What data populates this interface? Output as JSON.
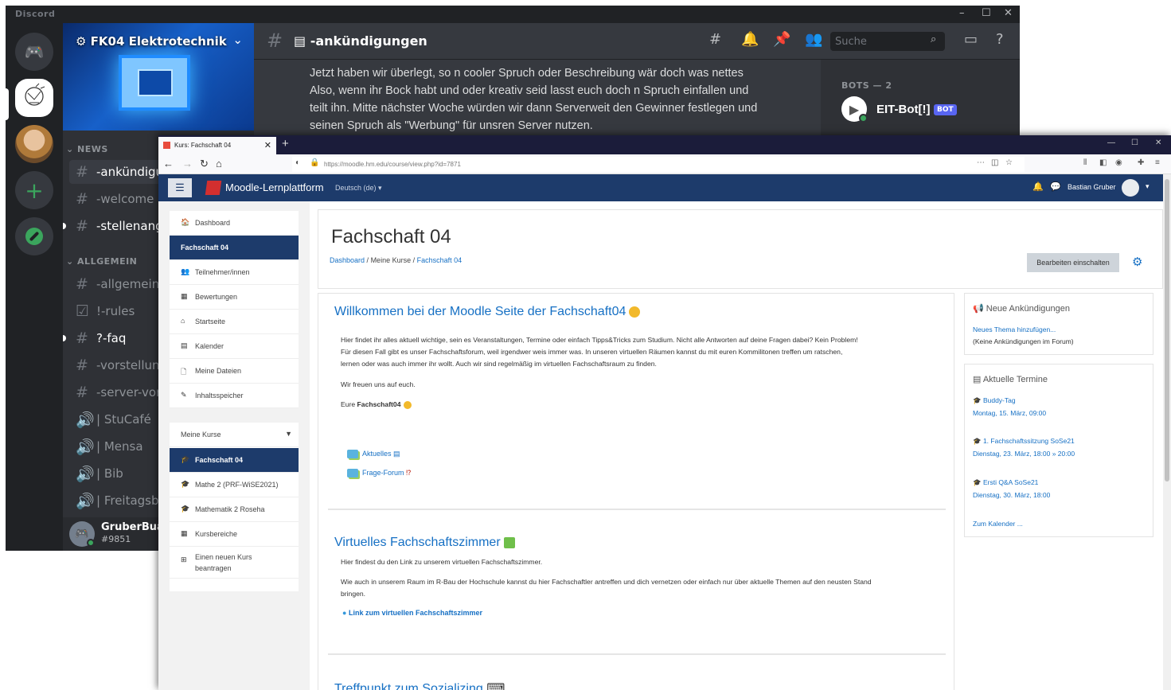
{
  "discord": {
    "app_title": "Discord",
    "window_controls": [
      "–",
      "☐",
      "✕"
    ],
    "server_name": "FK04 Elektrotechnik",
    "categories": [
      "NEWS",
      "ALLGEMEIN"
    ],
    "channels_news": [
      {
        "prefix": "#",
        "label": "-ankündigungen",
        "state": "active"
      },
      {
        "prefix": "#",
        "label": "-welcome",
        "state": "normal"
      },
      {
        "prefix": "#",
        "label": "-stellenangebote",
        "state": "unread"
      }
    ],
    "channels_allgemein": [
      {
        "prefix": "#",
        "label": "-allgemein",
        "state": "normal"
      },
      {
        "prefix": "☑",
        "label": "!-rules",
        "state": "normal"
      },
      {
        "prefix": "#",
        "label": "?-faq",
        "state": "unread"
      },
      {
        "prefix": "#",
        "label": "-vorstellungsrunde",
        "state": "normal"
      },
      {
        "prefix": "#",
        "label": "-server-vorschläge",
        "state": "normal"
      },
      {
        "prefix": "🔊",
        "label": "| StuCafé",
        "state": "normal"
      },
      {
        "prefix": "🔊",
        "label": "| Mensa",
        "state": "normal"
      },
      {
        "prefix": "🔊",
        "label": "| Bib",
        "state": "normal"
      },
      {
        "prefix": "🔊",
        "label": "| Freitagsbier",
        "state": "normal"
      }
    ],
    "user": {
      "name": "GruberBua",
      "tag": "#9851"
    },
    "channel_header": "-ankündigungen",
    "search_placeholder": "Suche",
    "message_lines": [
      "Jetzt haben wir überlegt, so n cooler Spruch oder Beschreibung wär doch was nettes",
      "Also, wenn ihr Bock habt und oder kreativ seid lasst euch doch n Spruch einfallen und",
      "teilt ihn. Mitte nächster Woche würden wir dann Serverweit den Gewinner festlegen und",
      "seinen Spruch als \"Werbung\" für unsren Server nutzen."
    ],
    "members_header": "BOTS — 2",
    "member_name": "EIT-Bot[!]",
    "bot_badge": "BOT",
    "colors": {
      "accent": "#5865f2",
      "online": "#3ba55d",
      "bg": "#36393f"
    }
  },
  "browser": {
    "tab_title": "Kurs: Fachschaft 04",
    "url": "https://moodle.hm.edu/course/view.php?id=7871"
  },
  "moodle": {
    "brand": "Moodle-Lernplattform",
    "language": "Deutsch (de) ▾",
    "user_name": "Bastian Gruber",
    "drawer_main": [
      {
        "icon": "🏠",
        "label": "Dashboard"
      },
      {
        "icon": "",
        "label": "Fachschaft 04",
        "active": true
      },
      {
        "icon": "👥",
        "label": "Teilnehmer/innen"
      },
      {
        "icon": "▦",
        "label": "Bewertungen"
      },
      {
        "icon": "⌂",
        "label": "Startseite"
      },
      {
        "icon": "▤",
        "label": "Kalender"
      },
      {
        "icon": "🗋",
        "label": "Meine Dateien"
      },
      {
        "icon": "✎",
        "label": "Inhaltsspeicher"
      }
    ],
    "my_courses_label": "Meine Kurse",
    "drawer_courses": [
      {
        "icon": "🎓",
        "label": "Fachschaft 04",
        "active": true
      },
      {
        "icon": "🎓",
        "label": "Mathe 2 (PRF-WiSE2021)"
      },
      {
        "icon": "🎓",
        "label": "Mathematik 2 Roseha"
      },
      {
        "icon": "▦",
        "label": "Kursbereiche"
      },
      {
        "icon": "⊞",
        "label": "Einen neuen Kurs beantragen"
      }
    ],
    "page_title": "Fachschaft 04",
    "breadcrumb": [
      "Dashboard",
      "Meine Kurse",
      "Fachschaft 04"
    ],
    "edit_button": "Bearbeiten einschalten",
    "section1": {
      "title": "Willkommen bei der Moodle Seite der Fachschaft04",
      "paragraph_lines": [
        "Hier findet ihr alles aktuell wichtige, sein es Veranstaltungen, Termine oder einfach Tipps&Tricks zum Studium. Nicht alle Antworten auf deine Fragen dabei? Kein Problem!",
        "Für diesen Fall gibt es unser Fachschaftsforum, weil irgendwer weis immer was. In unseren virtuellen Räumen kannst du mit euren Kommilitonen treffen um ratschen,",
        "lernen oder was auch immer ihr wollt. Auch wir sind regelmäßig im virtuellen Fachschaftsraum zu finden."
      ],
      "greeting": "Wir freuen uns auf euch.",
      "signature_prefix": "Eure",
      "signature_bold": "Fachschaft04",
      "links": [
        "Aktuelles",
        "Frage-Forum"
      ]
    },
    "section2": {
      "title": "Virtuelles Fachschaftszimmer",
      "line1": "Hier findest du den Link zu unserem virtuellen Fachschaftszimmer.",
      "line2": "Wie auch in unserem Raum im R-Bau der Hochschule kannst du hier Fachschaftler antreffen und dich vernetzen oder einfach nur über aktuelle Themen auf den neusten Stand",
      "line3": "bringen.",
      "link": "Link zum virtuellen Fachschaftszimmer"
    },
    "section3": {
      "title": "Treffpunkt zum Sozializing"
    },
    "block_news": {
      "title": "Neue Ankündigungen",
      "link": "Neues Thema hinzufügen...",
      "empty": "(Keine Ankündigungen im Forum)"
    },
    "block_events": {
      "title": "Aktuelle Termine",
      "events": [
        {
          "name": "Buddy-Tag",
          "date": "Montag, 15. März, 09:00"
        },
        {
          "name": "1. Fachschaftssitzung SoSe21",
          "date": "Dienstag, 23. März, 18:00 » 20:00"
        },
        {
          "name": "Ersti Q&A SoSe21",
          "date": "Dienstag, 30. März, 18:00"
        }
      ],
      "calendar_link": "Zum Kalender ..."
    },
    "colors": {
      "navbar": "#1d3b6b",
      "link": "#1670c4"
    }
  }
}
